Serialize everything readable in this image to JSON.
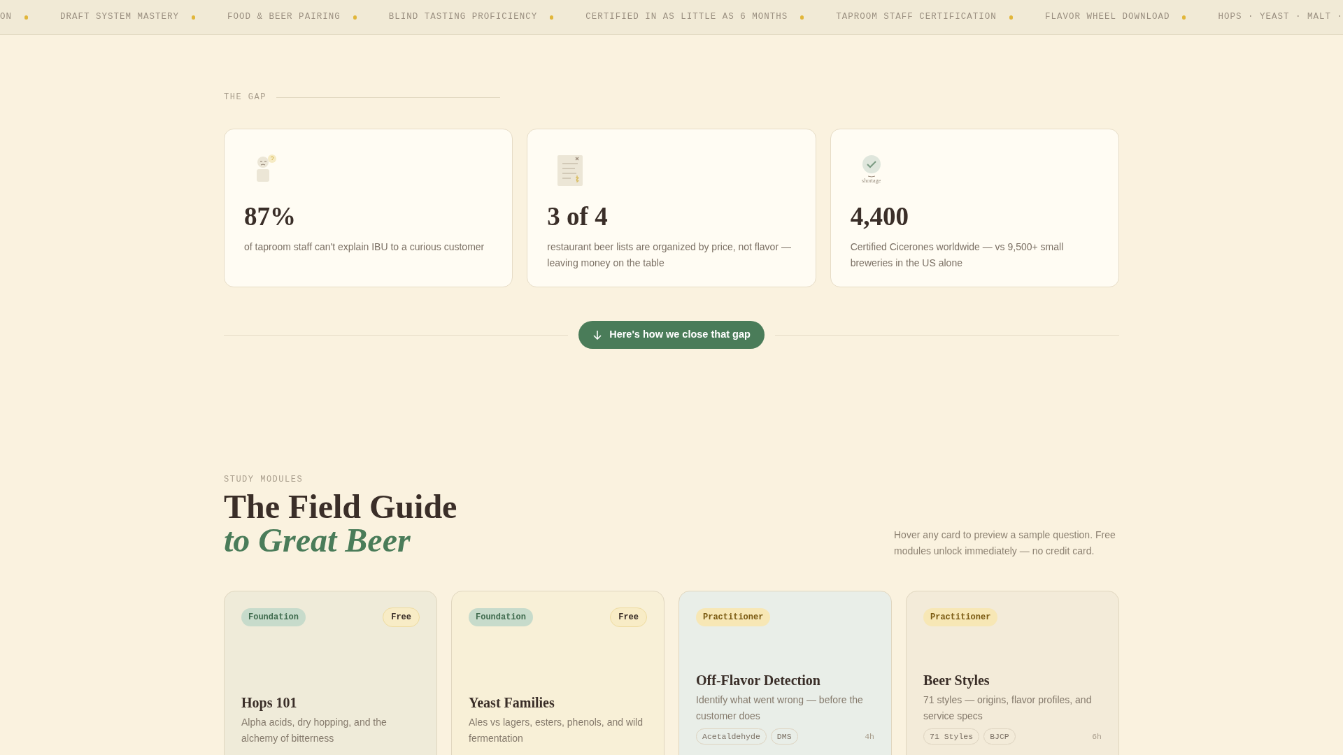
{
  "ticker": [
    "ON",
    "DRAFT SYSTEM MASTERY",
    "FOOD & BEER PAIRING",
    "BLIND TASTING PROFICIENCY",
    "CERTIFIED IN AS LITTLE AS 6 MONTHS",
    "TAPROOM STAFF CERTIFICATION",
    "FLAVOR WHEEL DOWNLOAD",
    "HOPS · YEAST · MALT ·"
  ],
  "gap": {
    "label": "THE GAP",
    "stats": [
      {
        "kind": "person",
        "value": "87%",
        "text": "of taproom staff can't explain IBU to a curious customer"
      },
      {
        "kind": "receipt",
        "value": "3 of 4",
        "text": "restaurant beer lists are organized by price, not flavor — leaving money on the table"
      },
      {
        "kind": "badge",
        "icon_caption": "shortage",
        "value": "4,400",
        "text": "Certified Cicerones worldwide — vs 9,500+ small breweries in the US alone"
      }
    ],
    "button": "Here's how we close that gap"
  },
  "modules": {
    "eyebrow": "STUDY MODULES",
    "title": "The Field Guide",
    "title_accent": "to Great Beer",
    "note": "Hover any card to preview a sample question. Free modules unlock immediately — no credit card.",
    "cards": [
      {
        "kind": "foundation",
        "level": "Foundation",
        "price": "Free",
        "title": "Hops 101",
        "text": "Alpha acids, dry hopping, and the alchemy of bitterness",
        "color": "#efebd9"
      },
      {
        "kind": "foundation",
        "level": "Foundation",
        "price": "Free",
        "title": "Yeast Families",
        "text": "Ales vs lagers, esters, phenols, and wild fermentation",
        "color": "#f8f0d7"
      },
      {
        "kind": "practitioner",
        "level": "Practitioner",
        "title": "Off-Flavor Detection",
        "text": "Identify what went wrong — before the customer does",
        "tags": [
          "Acetaldehyde",
          "DMS"
        ],
        "duration": "4h",
        "color": "#e9eee8"
      },
      {
        "kind": "practitioner",
        "level": "Practitioner",
        "title": "Beer Styles",
        "text": "71 styles — origins, flavor profiles, and service specs",
        "tags": [
          "71 Styles",
          "BJCP"
        ],
        "duration": "6h",
        "color": "#f3ebd9"
      }
    ]
  }
}
